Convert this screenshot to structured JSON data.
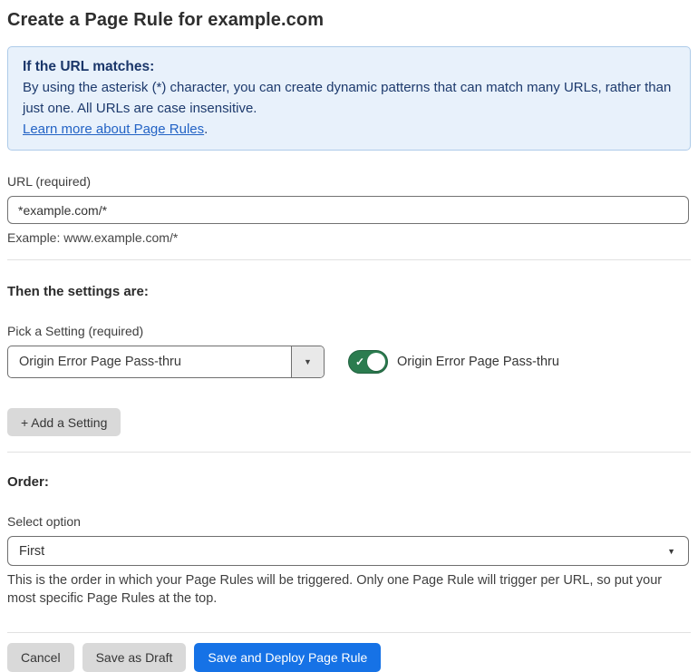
{
  "page": {
    "title": "Create a Page Rule for example.com"
  },
  "info_box": {
    "heading": "If the URL matches:",
    "body": "By using the asterisk (*) character, you can create dynamic patterns that can match many URLs, rather than just one. All URLs are case insensitive.",
    "link_label": "Learn more about Page Rules",
    "link_suffix": "."
  },
  "url_field": {
    "label": "URL (required)",
    "value": "*example.com/*",
    "helper": "Example: www.example.com/*"
  },
  "settings_section": {
    "heading": "Then the settings are:",
    "setting_label": "Pick a Setting (required)",
    "setting_value": "Origin Error Page Pass-thru",
    "toggle_state": "on",
    "toggle_label": "Origin Error Page Pass-thru",
    "add_setting_label": "+ Add a Setting"
  },
  "order_section": {
    "heading": "Order:",
    "select_label": "Select option",
    "select_value": "First",
    "helper": "This is the order in which your Page Rules will be triggered. Only one Page Rule will trigger per URL, so put your most specific Page Rules at the top."
  },
  "footer": {
    "cancel_label": "Cancel",
    "save_draft_label": "Save as Draft",
    "save_deploy_label": "Save and Deploy Page Rule"
  },
  "icons": {
    "toggle_check": "✓",
    "dropdown_arrow": "▼",
    "select_arrow": "▼"
  },
  "colors": {
    "info_bg": "#e8f1fb",
    "info_border": "#aecbe9",
    "info_text": "#1d3a6d",
    "link": "#2363c5",
    "toggle_on": "#2b7c4f",
    "primary_button": "#1672e6",
    "secondary_button": "#d9d9d9"
  }
}
